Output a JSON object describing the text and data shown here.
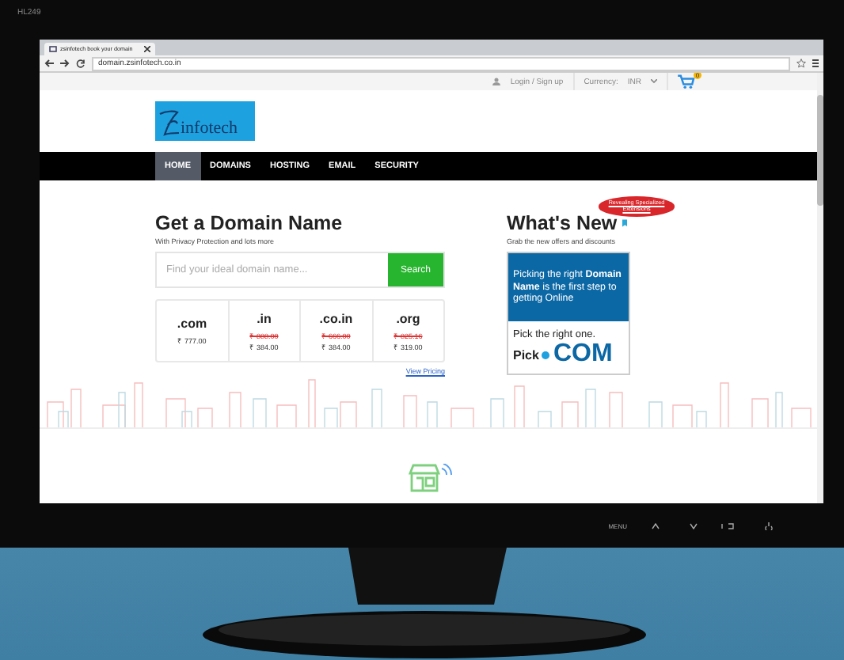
{
  "monitor": {
    "model": "HL249",
    "buttons": [
      "MENU"
    ]
  },
  "browser": {
    "tab_title": "zsinfotech book your domain",
    "url": "domain.zsinfotech.co.in"
  },
  "topbar": {
    "login": "Login / Sign up",
    "currency_label": "Currency:",
    "currency": "INR",
    "cart_count": "0"
  },
  "logo": {
    "text": "infotech"
  },
  "nav": [
    {
      "label": "HOME",
      "selected": true
    },
    {
      "label": "DOMAINS",
      "selected": false
    },
    {
      "label": "HOSTING",
      "selected": false
    },
    {
      "label": "EMAIL",
      "selected": false
    },
    {
      "label": "SECURITY",
      "selected": false
    }
  ],
  "search": {
    "title": "Get a Domain Name",
    "subtitle": "With Privacy Protection and lots more",
    "placeholder": "Find your ideal domain name...",
    "button": "Search"
  },
  "extensions": [
    {
      "name": ".com",
      "price": "₹ 777.00"
    },
    {
      "name": ".in",
      "old_price": "₹ 888.00",
      "price": "₹ 384.00"
    },
    {
      "name": ".co.in",
      "old_price": "₹ 666.00",
      "price": "₹ 384.00"
    },
    {
      "name": ".org",
      "old_price": "₹ 825.16",
      "price": "₹ 319.00"
    }
  ],
  "view_pricing": "View Pricing",
  "whats_new": {
    "title": "What's New",
    "subtitle": "Grab the new offers and discounts",
    "tag": "Revealing Specialized Extensions",
    "banner": {
      "headline": "Picking the right **Domain Name** is the first step to getting Online",
      "tagline": "Pick the right one.",
      "brand_prefix": "Pick",
      "brand": "COM"
    }
  }
}
